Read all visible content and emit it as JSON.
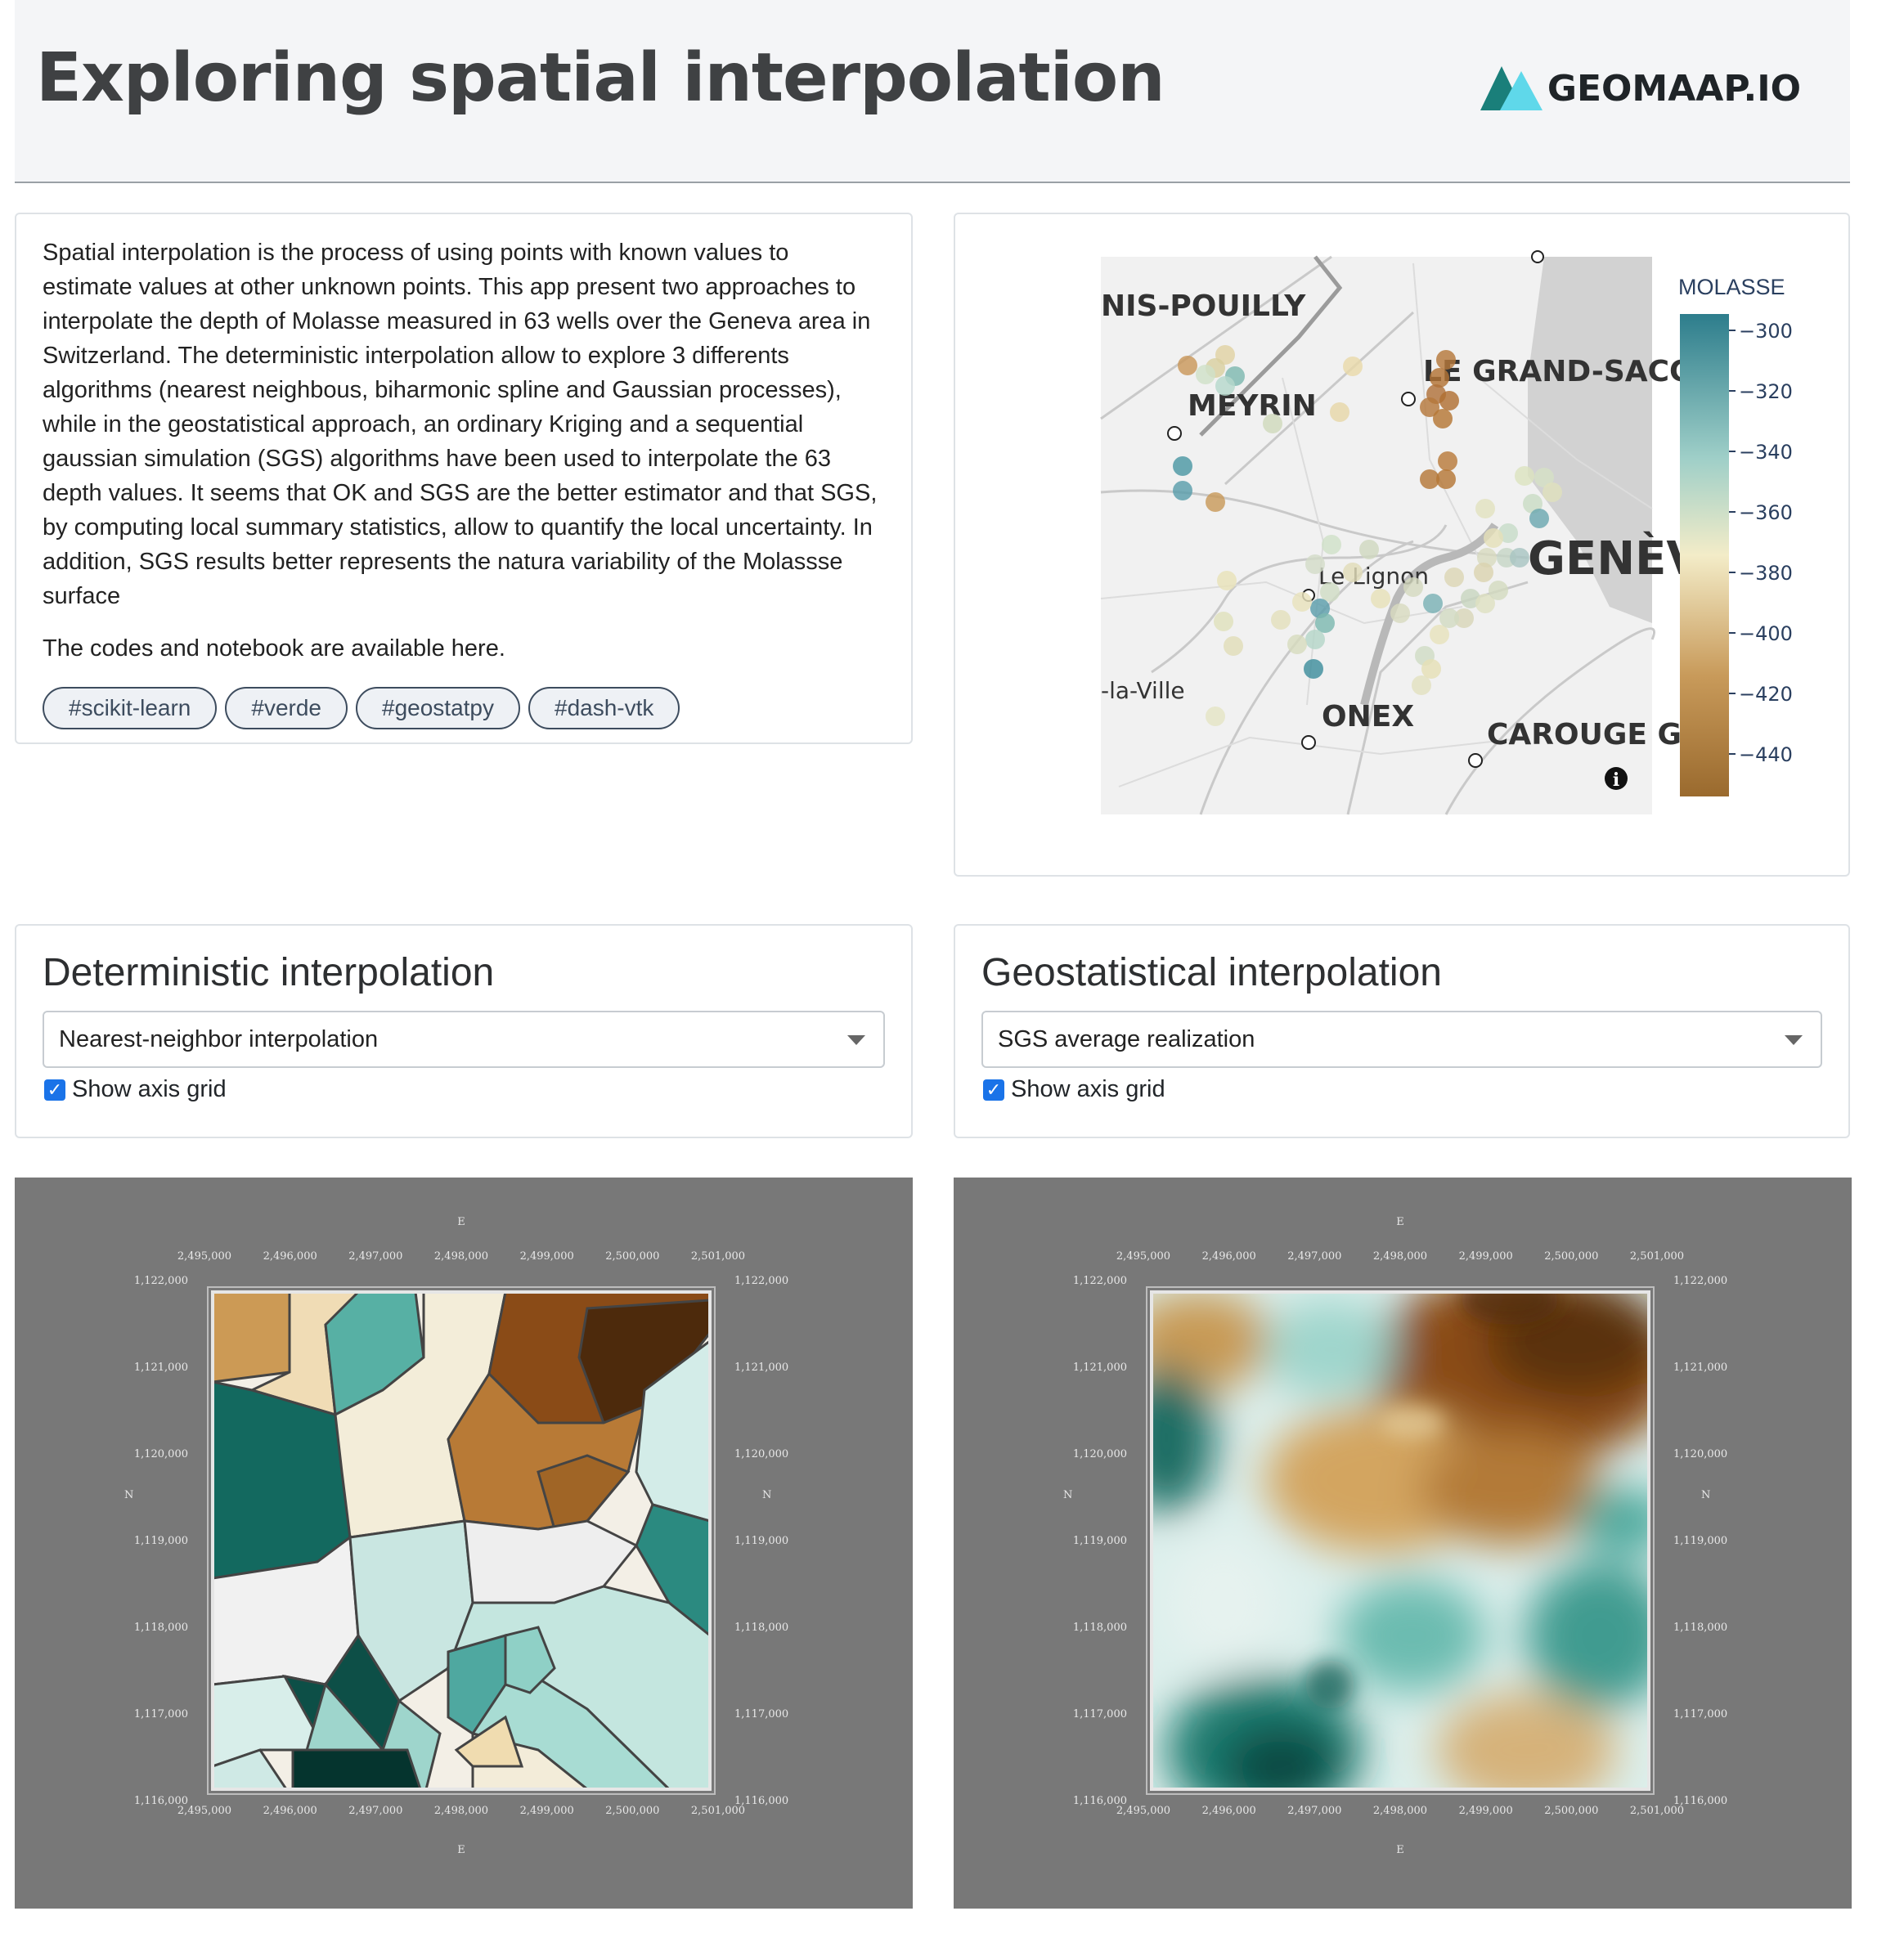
{
  "header": {
    "title": "Exploring spatial interpolation",
    "logo_text": "GEOMAAP.IO"
  },
  "intro": {
    "paragraph": "Spatial interpolation is the process of using points with known values to estimate values at other unknown points. This app present two approaches to interpolate the depth of Molasse measured in 63 wells over the Geneva area in Switzerland. The deterministic interpolation allow to explore 3 differents algorithms (nearest neighbous, biharmonic spline and Gaussian processes), while in the geostatistical approach, an ordinary Kriging and a sequential gaussian simulation (SGS) algorithms have been used to interpolate the 63 depth values. It seems that OK and SGS are the better estimator and that SGS, by computing local summary statistics, allow to quantify the local uncertainty. In addition, SGS results better represents the natura variability of the Molassse surface",
    "codes_note": "The codes and notebook are available here.",
    "tags": [
      "#scikit-learn",
      "#verde",
      "#geostatpy",
      "#dash-vtk"
    ]
  },
  "map": {
    "place_labels": [
      "NIS-POUILLY",
      "MEYRIN",
      "LE GRAND-SACC",
      "GENÈV",
      "Le Lignon",
      "-la-Ville",
      "ONEX",
      "CAROUGE G"
    ],
    "colorbar_title": "MOLASSE",
    "colorbar_ticks": [
      "−300",
      "−320",
      "−340",
      "−360",
      "−380",
      "−400",
      "−420",
      "−440"
    ],
    "info_icon": "info-icon",
    "colors": {
      "low": "#9a6a2e",
      "mid": "#f3ecc8",
      "high": "#2d7d8c"
    }
  },
  "deterministic": {
    "heading": "Deterministic interpolation",
    "method": "Nearest-neighbor interpolation",
    "show_grid_label": "Show axis grid",
    "show_grid": true
  },
  "geostatistical": {
    "heading": "Geostatistical interpolation",
    "method": "SGS average realization",
    "show_grid_label": "Show axis grid",
    "show_grid": true
  },
  "plot_axes": {
    "x_title": "E",
    "y_title": "N",
    "x_ticks": [
      "2,495,000",
      "2,496,000",
      "2,497,000",
      "2,498,000",
      "2,499,000",
      "2,500,000",
      "2,501,000"
    ],
    "y_ticks": [
      "1,122,000",
      "1,121,000",
      "1,120,000",
      "1,119,000",
      "1,118,000",
      "1,117,000",
      "1,116,000"
    ]
  }
}
